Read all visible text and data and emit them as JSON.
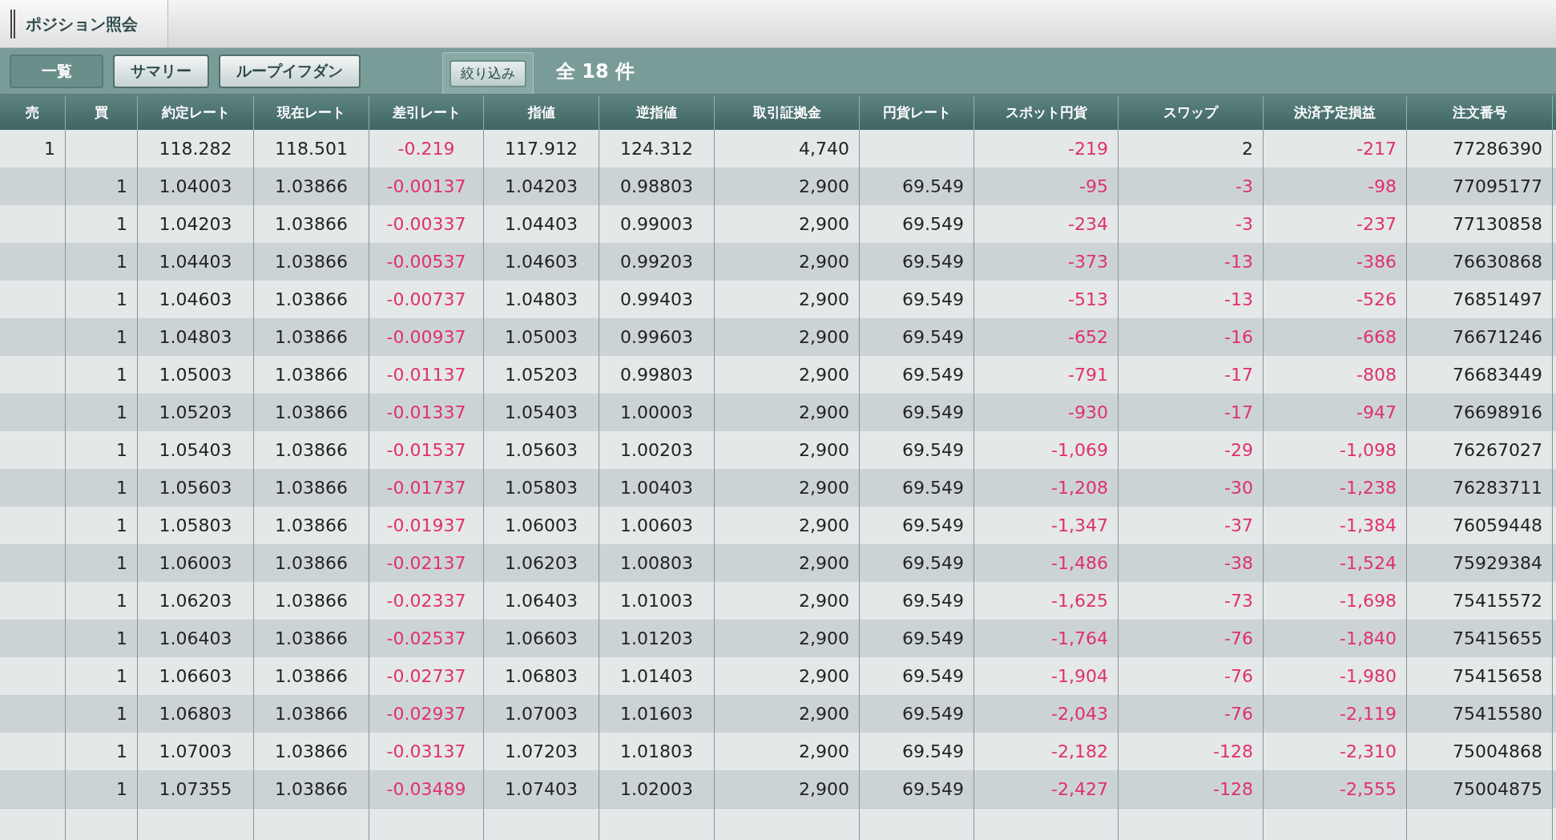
{
  "window": {
    "title": "ポジション照会"
  },
  "tabs": [
    {
      "label": "一覧",
      "selected": true
    },
    {
      "label": "サマリー",
      "selected": false
    },
    {
      "label": "ループイフダン",
      "selected": false
    }
  ],
  "filter_button": "絞り込み",
  "total": "全 18 件",
  "table": {
    "columns": [
      "売",
      "買",
      "約定レート",
      "現在レート",
      "差引レート",
      "指値",
      "逆指値",
      "取引証拠金",
      "円貨レート",
      "スポット円貨",
      "スワップ",
      "決済予定損益",
      "注文番号"
    ],
    "rows": [
      {
        "cells": [
          {
            "text": "1",
            "negative": false
          },
          null,
          {
            "text": "118.282",
            "negative": false
          },
          {
            "text": "118.501",
            "negative": false
          },
          {
            "text": "-0.219",
            "negative": true
          },
          {
            "text": "117.912",
            "negative": false
          },
          {
            "text": "124.312",
            "negative": false
          },
          {
            "text": "4,740",
            "negative": false
          },
          null,
          {
            "text": "-219",
            "negative": true
          },
          {
            "text": "2",
            "negative": false
          },
          {
            "text": "-217",
            "negative": true
          },
          {
            "text": "77286390",
            "negative": false
          }
        ]
      },
      {
        "cells": [
          null,
          {
            "text": "1",
            "negative": false
          },
          {
            "text": "1.04003",
            "negative": false
          },
          {
            "text": "1.03866",
            "negative": false
          },
          {
            "text": "-0.00137",
            "negative": true
          },
          {
            "text": "1.04203",
            "negative": false
          },
          {
            "text": "0.98803",
            "negative": false
          },
          {
            "text": "2,900",
            "negative": false
          },
          {
            "text": "69.549",
            "negative": false
          },
          {
            "text": "-95",
            "negative": true
          },
          {
            "text": "-3",
            "negative": true
          },
          {
            "text": "-98",
            "negative": true
          },
          {
            "text": "77095177",
            "negative": false
          }
        ]
      },
      {
        "cells": [
          null,
          {
            "text": "1",
            "negative": false
          },
          {
            "text": "1.04203",
            "negative": false
          },
          {
            "text": "1.03866",
            "negative": false
          },
          {
            "text": "-0.00337",
            "negative": true
          },
          {
            "text": "1.04403",
            "negative": false
          },
          {
            "text": "0.99003",
            "negative": false
          },
          {
            "text": "2,900",
            "negative": false
          },
          {
            "text": "69.549",
            "negative": false
          },
          {
            "text": "-234",
            "negative": true
          },
          {
            "text": "-3",
            "negative": true
          },
          {
            "text": "-237",
            "negative": true
          },
          {
            "text": "77130858",
            "negative": false
          }
        ]
      },
      {
        "cells": [
          null,
          {
            "text": "1",
            "negative": false
          },
          {
            "text": "1.04403",
            "negative": false
          },
          {
            "text": "1.03866",
            "negative": false
          },
          {
            "text": "-0.00537",
            "negative": true
          },
          {
            "text": "1.04603",
            "negative": false
          },
          {
            "text": "0.99203",
            "negative": false
          },
          {
            "text": "2,900",
            "negative": false
          },
          {
            "text": "69.549",
            "negative": false
          },
          {
            "text": "-373",
            "negative": true
          },
          {
            "text": "-13",
            "negative": true
          },
          {
            "text": "-386",
            "negative": true
          },
          {
            "text": "76630868",
            "negative": false
          }
        ]
      },
      {
        "cells": [
          null,
          {
            "text": "1",
            "negative": false
          },
          {
            "text": "1.04603",
            "negative": false
          },
          {
            "text": "1.03866",
            "negative": false
          },
          {
            "text": "-0.00737",
            "negative": true
          },
          {
            "text": "1.04803",
            "negative": false
          },
          {
            "text": "0.99403",
            "negative": false
          },
          {
            "text": "2,900",
            "negative": false
          },
          {
            "text": "69.549",
            "negative": false
          },
          {
            "text": "-513",
            "negative": true
          },
          {
            "text": "-13",
            "negative": true
          },
          {
            "text": "-526",
            "negative": true
          },
          {
            "text": "76851497",
            "negative": false
          }
        ]
      },
      {
        "cells": [
          null,
          {
            "text": "1",
            "negative": false
          },
          {
            "text": "1.04803",
            "negative": false
          },
          {
            "text": "1.03866",
            "negative": false
          },
          {
            "text": "-0.00937",
            "negative": true
          },
          {
            "text": "1.05003",
            "negative": false
          },
          {
            "text": "0.99603",
            "negative": false
          },
          {
            "text": "2,900",
            "negative": false
          },
          {
            "text": "69.549",
            "negative": false
          },
          {
            "text": "-652",
            "negative": true
          },
          {
            "text": "-16",
            "negative": true
          },
          {
            "text": "-668",
            "negative": true
          },
          {
            "text": "76671246",
            "negative": false
          }
        ]
      },
      {
        "cells": [
          null,
          {
            "text": "1",
            "negative": false
          },
          {
            "text": "1.05003",
            "negative": false
          },
          {
            "text": "1.03866",
            "negative": false
          },
          {
            "text": "-0.01137",
            "negative": true
          },
          {
            "text": "1.05203",
            "negative": false
          },
          {
            "text": "0.99803",
            "negative": false
          },
          {
            "text": "2,900",
            "negative": false
          },
          {
            "text": "69.549",
            "negative": false
          },
          {
            "text": "-791",
            "negative": true
          },
          {
            "text": "-17",
            "negative": true
          },
          {
            "text": "-808",
            "negative": true
          },
          {
            "text": "76683449",
            "negative": false
          }
        ]
      },
      {
        "cells": [
          null,
          {
            "text": "1",
            "negative": false
          },
          {
            "text": "1.05203",
            "negative": false
          },
          {
            "text": "1.03866",
            "negative": false
          },
          {
            "text": "-0.01337",
            "negative": true
          },
          {
            "text": "1.05403",
            "negative": false
          },
          {
            "text": "1.00003",
            "negative": false
          },
          {
            "text": "2,900",
            "negative": false
          },
          {
            "text": "69.549",
            "negative": false
          },
          {
            "text": "-930",
            "negative": true
          },
          {
            "text": "-17",
            "negative": true
          },
          {
            "text": "-947",
            "negative": true
          },
          {
            "text": "76698916",
            "negative": false
          }
        ]
      },
      {
        "cells": [
          null,
          {
            "text": "1",
            "negative": false
          },
          {
            "text": "1.05403",
            "negative": false
          },
          {
            "text": "1.03866",
            "negative": false
          },
          {
            "text": "-0.01537",
            "negative": true
          },
          {
            "text": "1.05603",
            "negative": false
          },
          {
            "text": "1.00203",
            "negative": false
          },
          {
            "text": "2,900",
            "negative": false
          },
          {
            "text": "69.549",
            "negative": false
          },
          {
            "text": "-1,069",
            "negative": true
          },
          {
            "text": "-29",
            "negative": true
          },
          {
            "text": "-1,098",
            "negative": true
          },
          {
            "text": "76267027",
            "negative": false
          }
        ]
      },
      {
        "cells": [
          null,
          {
            "text": "1",
            "negative": false
          },
          {
            "text": "1.05603",
            "negative": false
          },
          {
            "text": "1.03866",
            "negative": false
          },
          {
            "text": "-0.01737",
            "negative": true
          },
          {
            "text": "1.05803",
            "negative": false
          },
          {
            "text": "1.00403",
            "negative": false
          },
          {
            "text": "2,900",
            "negative": false
          },
          {
            "text": "69.549",
            "negative": false
          },
          {
            "text": "-1,208",
            "negative": true
          },
          {
            "text": "-30",
            "negative": true
          },
          {
            "text": "-1,238",
            "negative": true
          },
          {
            "text": "76283711",
            "negative": false
          }
        ]
      },
      {
        "cells": [
          null,
          {
            "text": "1",
            "negative": false
          },
          {
            "text": "1.05803",
            "negative": false
          },
          {
            "text": "1.03866",
            "negative": false
          },
          {
            "text": "-0.01937",
            "negative": true
          },
          {
            "text": "1.06003",
            "negative": false
          },
          {
            "text": "1.00603",
            "negative": false
          },
          {
            "text": "2,900",
            "negative": false
          },
          {
            "text": "69.549",
            "negative": false
          },
          {
            "text": "-1,347",
            "negative": true
          },
          {
            "text": "-37",
            "negative": true
          },
          {
            "text": "-1,384",
            "negative": true
          },
          {
            "text": "76059448",
            "negative": false
          }
        ]
      },
      {
        "cells": [
          null,
          {
            "text": "1",
            "negative": false
          },
          {
            "text": "1.06003",
            "negative": false
          },
          {
            "text": "1.03866",
            "negative": false
          },
          {
            "text": "-0.02137",
            "negative": true
          },
          {
            "text": "1.06203",
            "negative": false
          },
          {
            "text": "1.00803",
            "negative": false
          },
          {
            "text": "2,900",
            "negative": false
          },
          {
            "text": "69.549",
            "negative": false
          },
          {
            "text": "-1,486",
            "negative": true
          },
          {
            "text": "-38",
            "negative": true
          },
          {
            "text": "-1,524",
            "negative": true
          },
          {
            "text": "75929384",
            "negative": false
          }
        ]
      },
      {
        "cells": [
          null,
          {
            "text": "1",
            "negative": false
          },
          {
            "text": "1.06203",
            "negative": false
          },
          {
            "text": "1.03866",
            "negative": false
          },
          {
            "text": "-0.02337",
            "negative": true
          },
          {
            "text": "1.06403",
            "negative": false
          },
          {
            "text": "1.01003",
            "negative": false
          },
          {
            "text": "2,900",
            "negative": false
          },
          {
            "text": "69.549",
            "negative": false
          },
          {
            "text": "-1,625",
            "negative": true
          },
          {
            "text": "-73",
            "negative": true
          },
          {
            "text": "-1,698",
            "negative": true
          },
          {
            "text": "75415572",
            "negative": false
          }
        ]
      },
      {
        "cells": [
          null,
          {
            "text": "1",
            "negative": false
          },
          {
            "text": "1.06403",
            "negative": false
          },
          {
            "text": "1.03866",
            "negative": false
          },
          {
            "text": "-0.02537",
            "negative": true
          },
          {
            "text": "1.06603",
            "negative": false
          },
          {
            "text": "1.01203",
            "negative": false
          },
          {
            "text": "2,900",
            "negative": false
          },
          {
            "text": "69.549",
            "negative": false
          },
          {
            "text": "-1,764",
            "negative": true
          },
          {
            "text": "-76",
            "negative": true
          },
          {
            "text": "-1,840",
            "negative": true
          },
          {
            "text": "75415655",
            "negative": false
          }
        ]
      },
      {
        "cells": [
          null,
          {
            "text": "1",
            "negative": false
          },
          {
            "text": "1.06603",
            "negative": false
          },
          {
            "text": "1.03866",
            "negative": false
          },
          {
            "text": "-0.02737",
            "negative": true
          },
          {
            "text": "1.06803",
            "negative": false
          },
          {
            "text": "1.01403",
            "negative": false
          },
          {
            "text": "2,900",
            "negative": false
          },
          {
            "text": "69.549",
            "negative": false
          },
          {
            "text": "-1,904",
            "negative": true
          },
          {
            "text": "-76",
            "negative": true
          },
          {
            "text": "-1,980",
            "negative": true
          },
          {
            "text": "75415658",
            "negative": false
          }
        ]
      },
      {
        "cells": [
          null,
          {
            "text": "1",
            "negative": false
          },
          {
            "text": "1.06803",
            "negative": false
          },
          {
            "text": "1.03866",
            "negative": false
          },
          {
            "text": "-0.02937",
            "negative": true
          },
          {
            "text": "1.07003",
            "negative": false
          },
          {
            "text": "1.01603",
            "negative": false
          },
          {
            "text": "2,900",
            "negative": false
          },
          {
            "text": "69.549",
            "negative": false
          },
          {
            "text": "-2,043",
            "negative": true
          },
          {
            "text": "-76",
            "negative": true
          },
          {
            "text": "-2,119",
            "negative": true
          },
          {
            "text": "75415580",
            "negative": false
          }
        ]
      },
      {
        "cells": [
          null,
          {
            "text": "1",
            "negative": false
          },
          {
            "text": "1.07003",
            "negative": false
          },
          {
            "text": "1.03866",
            "negative": false
          },
          {
            "text": "-0.03137",
            "negative": true
          },
          {
            "text": "1.07203",
            "negative": false
          },
          {
            "text": "1.01803",
            "negative": false
          },
          {
            "text": "2,900",
            "negative": false
          },
          {
            "text": "69.549",
            "negative": false
          },
          {
            "text": "-2,182",
            "negative": true
          },
          {
            "text": "-128",
            "negative": true
          },
          {
            "text": "-2,310",
            "negative": true
          },
          {
            "text": "75004868",
            "negative": false
          }
        ]
      },
      {
        "cells": [
          null,
          {
            "text": "1",
            "negative": false
          },
          {
            "text": "1.07355",
            "negative": false
          },
          {
            "text": "1.03866",
            "negative": false
          },
          {
            "text": "-0.03489",
            "negative": true
          },
          {
            "text": "1.07403",
            "negative": false
          },
          {
            "text": "1.02003",
            "negative": false
          },
          {
            "text": "2,900",
            "negative": false
          },
          {
            "text": "69.549",
            "negative": false
          },
          {
            "text": "-2,427",
            "negative": true
          },
          {
            "text": "-128",
            "negative": true
          },
          {
            "text": "-2,555",
            "negative": true
          },
          {
            "text": "75004875",
            "negative": false
          }
        ]
      }
    ]
  }
}
